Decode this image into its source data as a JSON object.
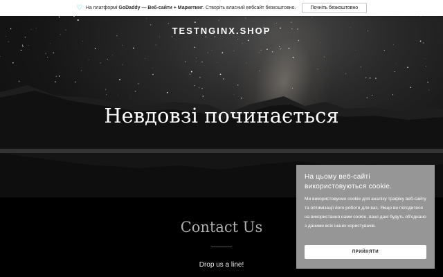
{
  "banner": {
    "icon": "godaddy-heart-icon",
    "prefix": "На платформі ",
    "brand": "GoDaddy — Веб-сайти + Маркетинг",
    "suffix": ". Створіть власний вебсайт безкоштовно.",
    "button_label": "Почніть безкоштовно"
  },
  "header": {
    "site_name": "TESTNGINX.SHOP"
  },
  "hero": {
    "title": "Невдовзі починається"
  },
  "contact": {
    "title": "Contact Us",
    "subtitle": "Drop us a line!"
  },
  "cookie_notice": {
    "title": "На цьому веб-сайті використовуються cookie.",
    "body": "Ми використовуємо cookie для аналізу трафіку веб-сайту та оптимізації його роботи для вас. Якщо ви погодитеся на використання нами cookie, ваші дані будуть об'єднано з даними всіх інших користувачів.",
    "button_label": "ПРИЙНЯТИ"
  },
  "colors": {
    "banner_icon": "#1bdbdb",
    "cookie_bg": "#9c9c9c",
    "contact_bg": "#000000"
  }
}
